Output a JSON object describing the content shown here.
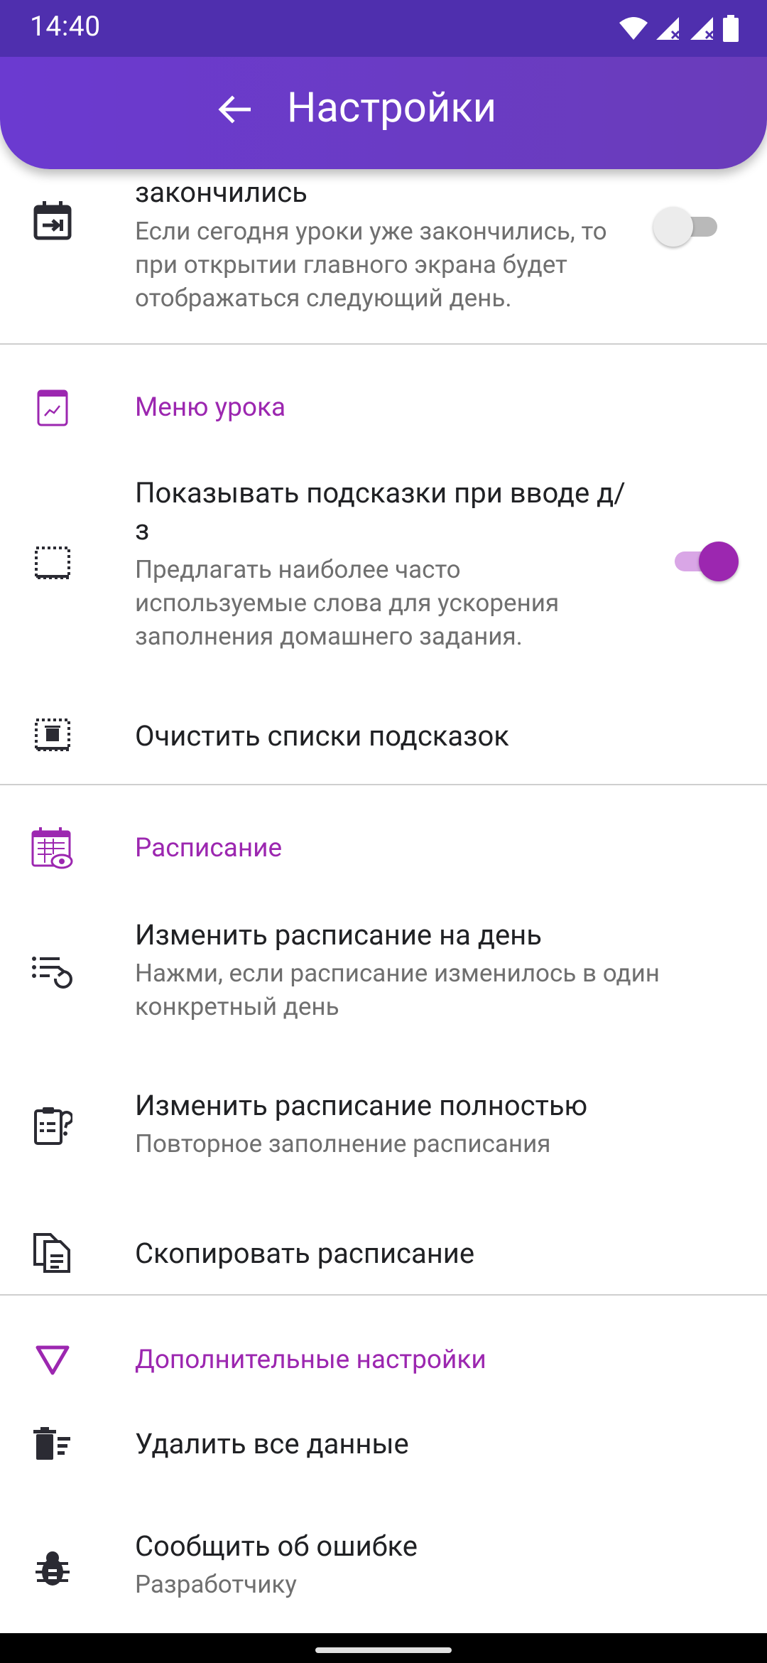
{
  "status_bar": {
    "time": "14:40"
  },
  "app_bar": {
    "title": "Настройки"
  },
  "items": {
    "lessons_over": {
      "title_partial": "закончились",
      "summary": "Если сегодня уроки уже закончились, то при открытии главного экрана будет отображаться следующий день.",
      "enabled": false
    },
    "lesson_menu_category": {
      "title": "Меню урока"
    },
    "hints": {
      "title": "Показывать подсказки при вводе д/з",
      "summary": "Предлагать наиболее часто используемые слова для ускорения заполнения домашнего задания.",
      "enabled": true
    },
    "clear_hints": {
      "title": "Очистить списки подсказок"
    },
    "schedule_category": {
      "title": "Расписание"
    },
    "change_day": {
      "title": "Изменить расписание на день",
      "summary": "Нажми, если расписание изменилось в один конкретный день"
    },
    "change_full": {
      "title": "Изменить расписание полностью",
      "summary": "Повторное заполнение расписания"
    },
    "copy_schedule": {
      "title": "Скопировать расписание"
    },
    "extra_category": {
      "title": "Дополнительные настройки"
    },
    "delete_all": {
      "title": "Удалить все данные"
    },
    "report_bug": {
      "title": "Сообщить об ошибке",
      "summary": "Разработчику"
    }
  },
  "colors": {
    "accent": "#9c27b0",
    "app_bar": "#6a3cba",
    "status_bar": "#4f2fae"
  }
}
